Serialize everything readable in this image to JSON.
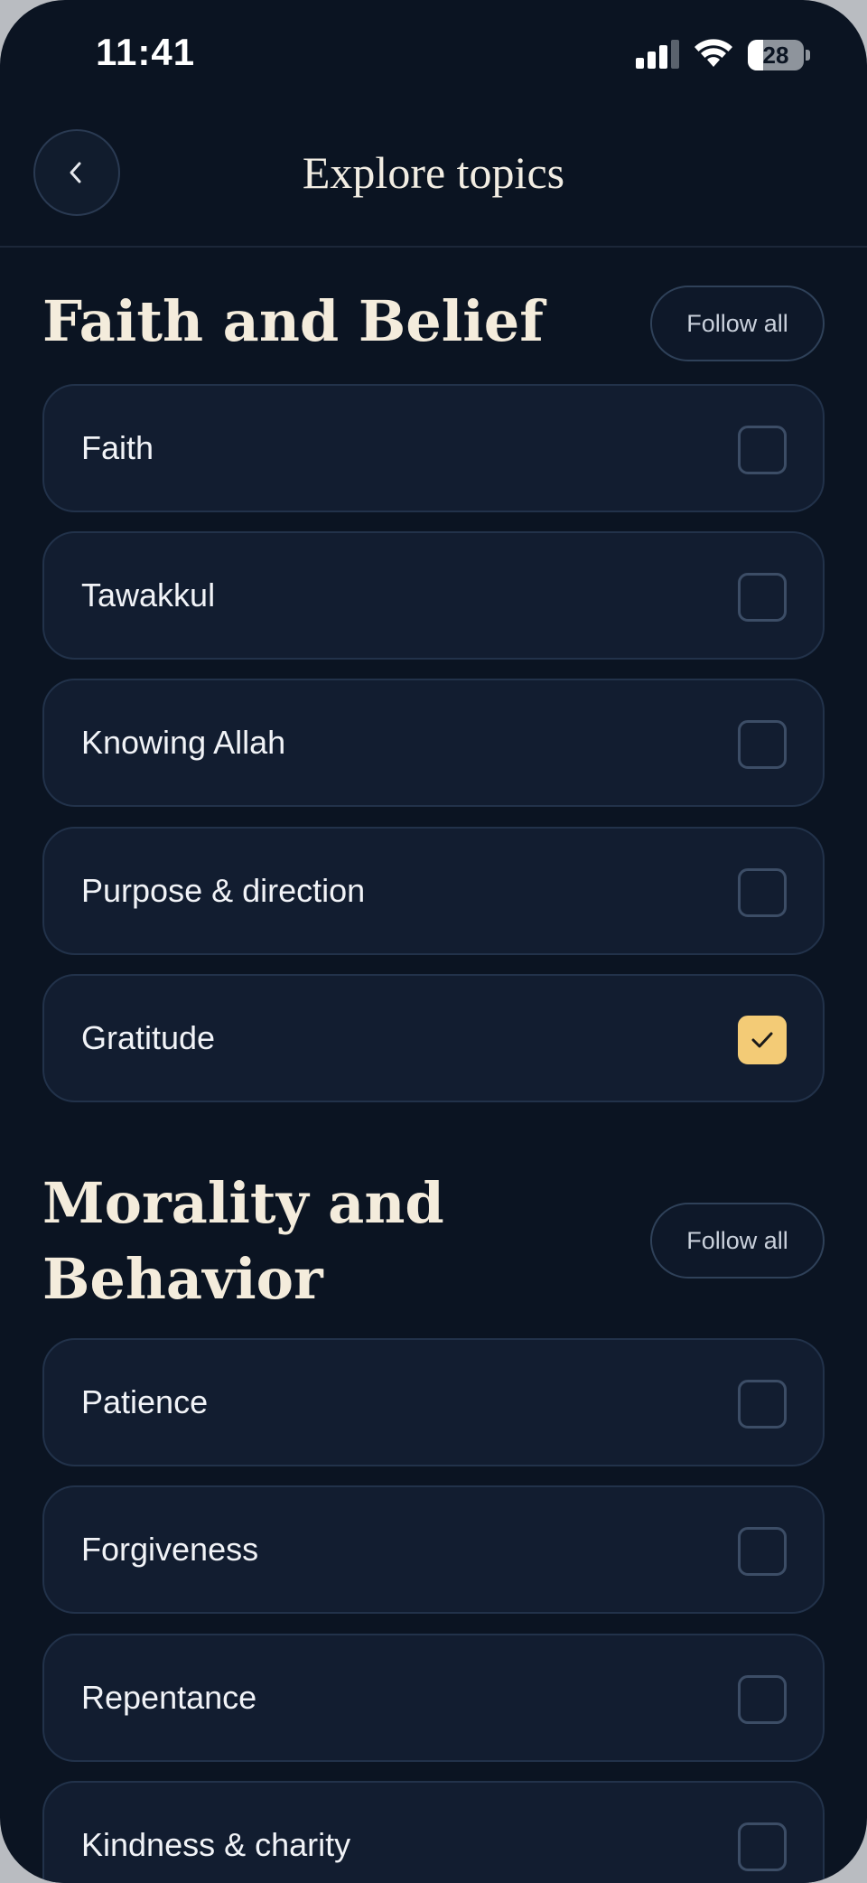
{
  "status_bar": {
    "time": "11:41",
    "battery_percent": "28",
    "battery_level": 0.28
  },
  "header": {
    "title": "Explore topics",
    "back_icon": "chevron-left-icon"
  },
  "sections": [
    {
      "title": "Faith and Belief",
      "follow_all_label": "Follow all",
      "topics": [
        {
          "label": "Faith",
          "checked": false
        },
        {
          "label": "Tawakkul",
          "checked": false
        },
        {
          "label": "Knowing Allah",
          "checked": false
        },
        {
          "label": "Purpose & direction",
          "checked": false
        },
        {
          "label": "Gratitude",
          "checked": true
        }
      ]
    },
    {
      "title": "Morality and Behavior",
      "follow_all_label": "Follow all",
      "topics": [
        {
          "label": "Patience",
          "checked": false
        },
        {
          "label": "Forgiveness",
          "checked": false
        },
        {
          "label": "Repentance",
          "checked": false
        },
        {
          "label": "Kindness & charity",
          "checked": false
        }
      ]
    }
  ],
  "colors": {
    "background": "#0b1422",
    "card": "#121d30",
    "accent_checked": "#f3cb76",
    "heading": "#f4ecdc"
  }
}
